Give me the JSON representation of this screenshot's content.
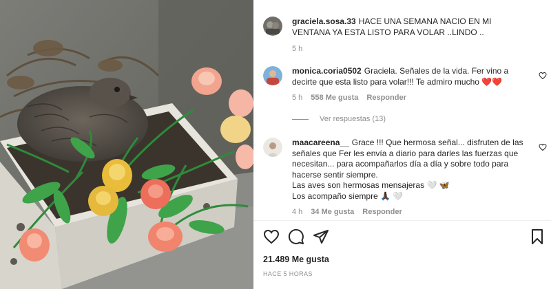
{
  "post": {
    "author": "graciela.sosa.33",
    "caption": "HACE UNA SEMANA NACIO EN MI VENTANA YA ESTA LISTO PARA VOLAR ..LINDO ..",
    "age": "5 h"
  },
  "comments": [
    {
      "user": "monica.coria0502",
      "text": "Graciela. Señales de la vida. Fer vino a decirte que esta listo para volar!!! Te admiro mucho",
      "emoji": "❤️❤️",
      "age": "5 h",
      "likes": "558 Me gusta",
      "reply": "Responder"
    },
    {
      "user": "maacareena__",
      "text_lines": [
        "Grace !!! Que hermosa señal... disfruten de las señales que Fer les envía a diario para darles las fuerzas que necesitan... para acompañarlos día a día y sobre todo para hacerse sentir siempre.",
        "Las aves son hermosas mensajeras",
        "Los acompaño siempre"
      ],
      "emoji_line2": "🤍 🦋",
      "emoji_line3": "🙏🏿 🤍",
      "age": "4 h",
      "likes": "34 Me gusta",
      "reply": "Responder"
    }
  ],
  "view_replies": "Ver respuestas (13)",
  "likes_total": "21.489 Me gusta",
  "timestamp": "HACE 5 HORAS",
  "colors": {
    "heart": "#d1142b",
    "meta": "#8e8e8e",
    "text": "#262626"
  }
}
